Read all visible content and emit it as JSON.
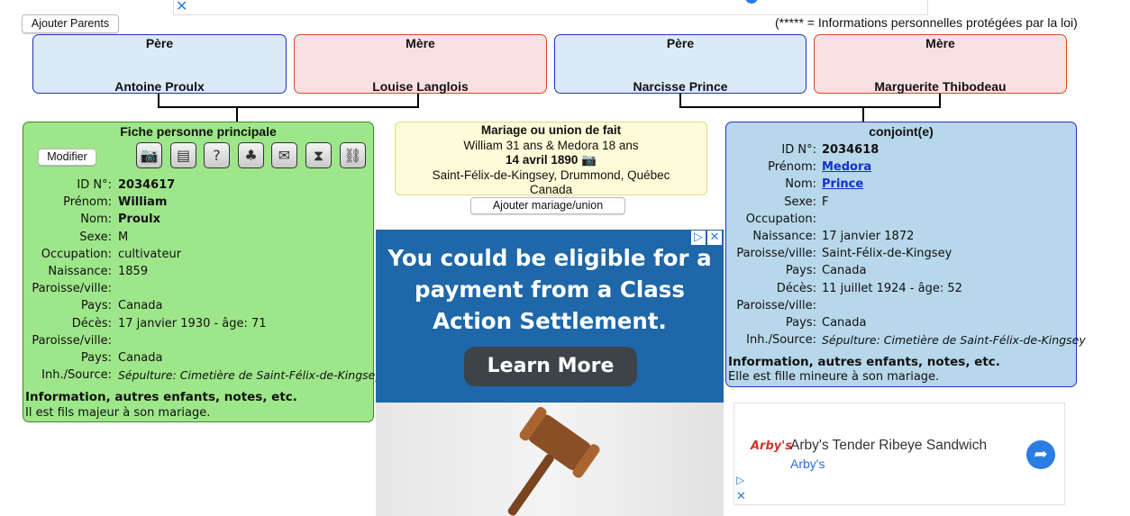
{
  "top_buttons": {
    "ajouter_parents": "Ajouter Parents"
  },
  "notice": "(***** = Informations personnelles protégées par la loi)",
  "parents": [
    {
      "role": "Père",
      "name": "Antoine Proulx"
    },
    {
      "role": "Mère",
      "name": "Louise Langlois"
    },
    {
      "role": "Père",
      "name": "Narcisse Prince"
    },
    {
      "role": "Mère",
      "name": "Marguerite Thibodeau"
    }
  ],
  "main_person": {
    "title": "Fiche personne principale",
    "modifier": "Modifier",
    "fields": [
      {
        "label": "ID N°:",
        "value": "2034617",
        "style": "bold"
      },
      {
        "label": "Prénom:",
        "value": "William",
        "style": "bold"
      },
      {
        "label": "Nom:",
        "value": "Proulx",
        "style": "bold"
      },
      {
        "label": "Sexe:",
        "value": "M",
        "style": ""
      },
      {
        "label": "Occupation:",
        "value": "cultivateur",
        "style": ""
      },
      {
        "label": "Naissance:",
        "value": "1859",
        "style": ""
      },
      {
        "label": "Paroisse/ville:",
        "value": "",
        "style": ""
      },
      {
        "label": "Pays:",
        "value": "Canada",
        "style": ""
      },
      {
        "label": "Décès:",
        "value": "17 janvier 1930 - âge: 71",
        "style": ""
      },
      {
        "label": "Paroisse/ville:",
        "value": "",
        "style": ""
      },
      {
        "label": "Pays:",
        "value": "Canada",
        "style": ""
      },
      {
        "label": "Inh./Source:",
        "value": "Sépulture: Cimetière de Saint-Félix-de-Kingsey",
        "style": "italic"
      }
    ],
    "info_heading": "Information, autres enfants, notes, etc.",
    "info_text": "Il est fils majeur à son mariage."
  },
  "mariage": {
    "title": "Mariage ou union de fait",
    "ages": "William 31 ans & Medora 18 ans",
    "date": "14 avril 1890",
    "place": "Saint-Félix-de-Kingsey, Drummond, Québec",
    "country": "Canada",
    "add_button": "Ajouter mariage/union"
  },
  "spouse": {
    "title": "conjoint(e)",
    "fields": [
      {
        "label": "ID N°:",
        "value": "2034618",
        "style": "bold"
      },
      {
        "label": "Prénom:",
        "value": "Medora",
        "style": "link"
      },
      {
        "label": "Nom:",
        "value": "Prince",
        "style": "link"
      },
      {
        "label": "Sexe:",
        "value": "F",
        "style": ""
      },
      {
        "label": "Occupation:",
        "value": "",
        "style": ""
      },
      {
        "label": "Naissance:",
        "value": "17 janvier 1872",
        "style": ""
      },
      {
        "label": "Paroisse/ville:",
        "value": "Saint-Félix-de-Kingsey",
        "style": ""
      },
      {
        "label": "Pays:",
        "value": "Canada",
        "style": ""
      },
      {
        "label": "Décès:",
        "value": "11 juillet 1924 - âge: 52",
        "style": ""
      },
      {
        "label": "Paroisse/ville:",
        "value": "",
        "style": ""
      },
      {
        "label": "Pays:",
        "value": "Canada",
        "style": ""
      },
      {
        "label": "Inh./Source:",
        "value": "Sépulture: Cimetière de Saint-Félix-de-Kingsey",
        "style": "italic"
      }
    ],
    "info_heading": "Information, autres enfants, notes, etc.",
    "info_text": "Elle est fille mineure à son mariage."
  },
  "ad": {
    "headline_lines": [
      "You could be eligible for a",
      "payment from a Class",
      "Action Settlement."
    ],
    "cta": "Learn More"
  },
  "arby_ad": {
    "logo": "Arby's",
    "title": "Arby's Tender Ribeye Sandwich",
    "brand": "Arby's"
  },
  "icons": [
    "camera-icon",
    "document-icon",
    "family-question-icon",
    "tree-icon",
    "mail-icon",
    "hourglass-icon",
    "link-icon"
  ],
  "colors": {
    "male": "#dbeaf4",
    "female": "#f9e1e3",
    "main_card": "#9ee68a",
    "spouse_card": "#b7d7ea",
    "mariage": "#fefcd8",
    "link": "#1133cc"
  }
}
